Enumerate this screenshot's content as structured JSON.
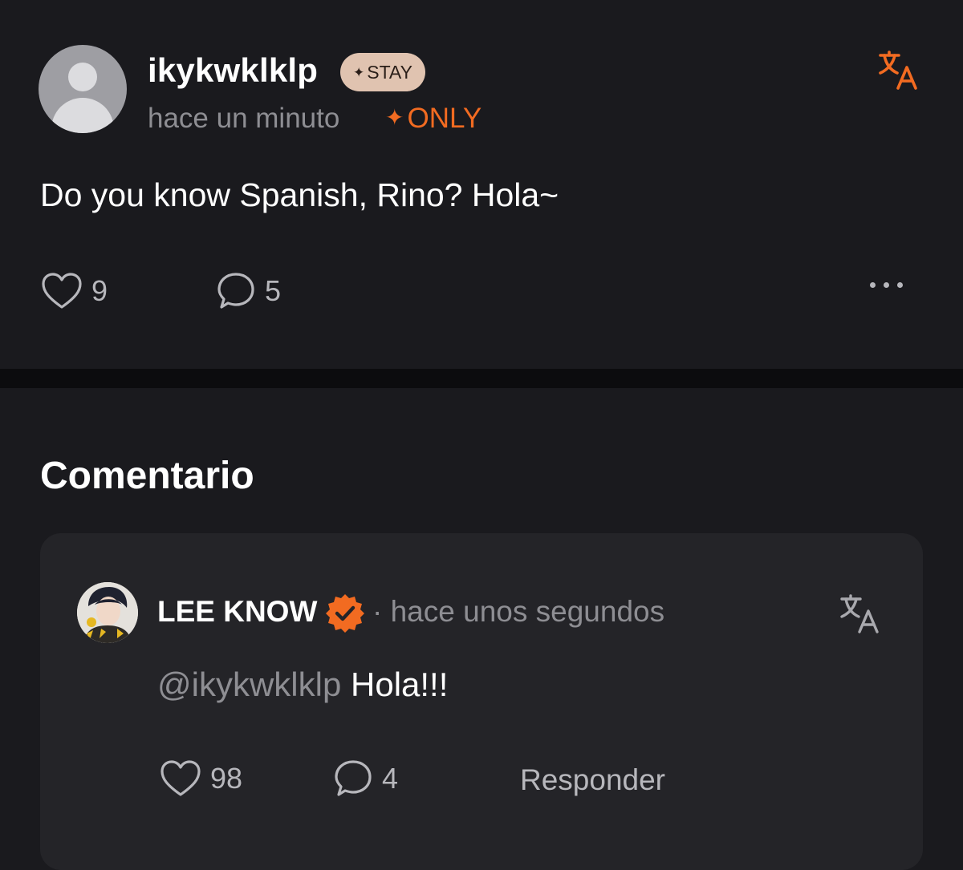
{
  "post": {
    "username": "ikykwklklp",
    "badge_label": "STAY",
    "badge_star": "✦",
    "timestamp": "hace un minuto",
    "only_label": "ONLY",
    "only_star": "✦",
    "text": "Do you know Spanish, Rino? Hola~",
    "likes": "9",
    "comments": "5"
  },
  "comments_section": {
    "title": "Comentario"
  },
  "comment": {
    "author": "LEE KNOW",
    "separator": "·",
    "timestamp": "hace unos segundos",
    "mention": "@ikykwklklp",
    "text": "Hola!!!",
    "likes": "98",
    "replies": "4",
    "reply_label": "Responder"
  },
  "colors": {
    "accent": "#f26b21",
    "background": "#1a1a1e",
    "card": "#242428",
    "muted_text": "#8e8e93"
  },
  "icons": [
    "translate-icon",
    "heart-icon",
    "comment-bubble-icon",
    "more-dots-icon",
    "verified-badge-icon"
  ]
}
